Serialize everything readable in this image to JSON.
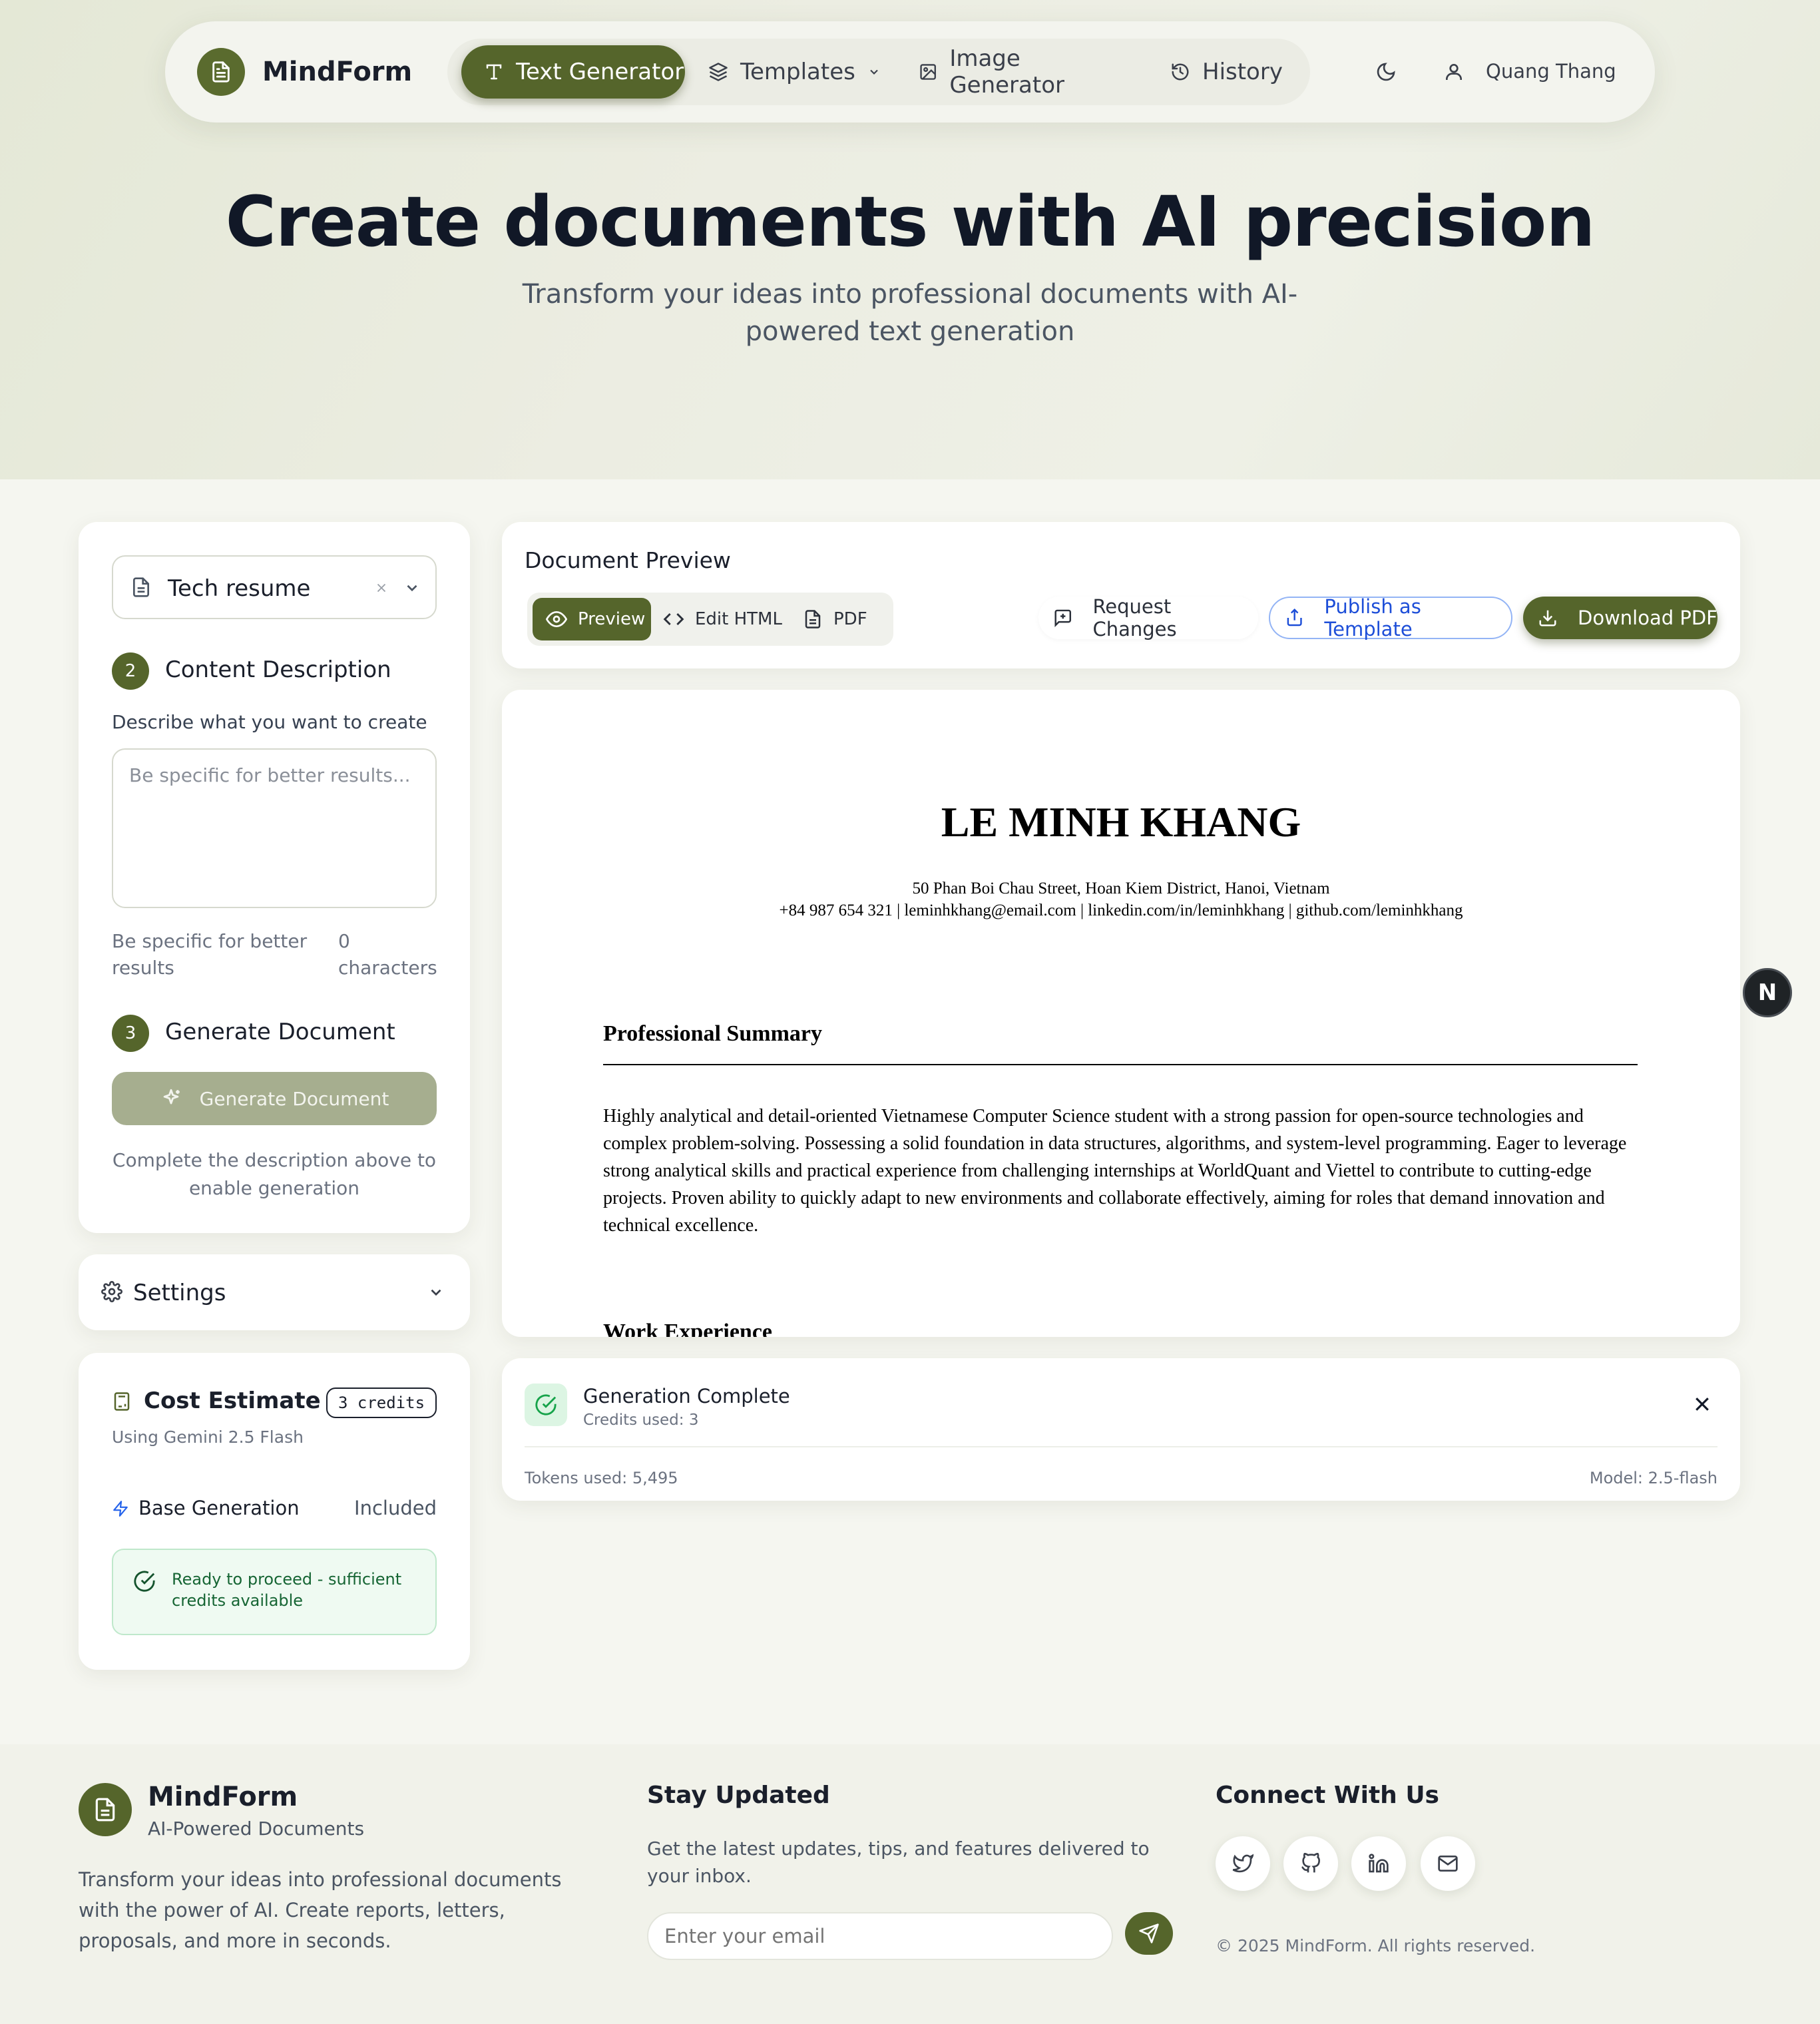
{
  "brand": {
    "name": "MindForm"
  },
  "nav": {
    "tabs": [
      {
        "label": "Text Generator",
        "icon": "text-icon",
        "active": true
      },
      {
        "label": "Templates",
        "icon": "layers-icon",
        "active": false
      },
      {
        "label": "Image Generator",
        "icon": "image-icon",
        "active": false
      },
      {
        "label": "History",
        "icon": "history-icon",
        "active": false
      }
    ],
    "user_name": "Quang Thang"
  },
  "hero": {
    "title": "Create documents with AI precision",
    "subtitle": "Transform your ideas into professional documents with AI-powered text generation"
  },
  "left": {
    "template_select": {
      "value": "Tech resume"
    },
    "step2": {
      "number": "2",
      "label": "Content Description"
    },
    "description_label": "Describe what you want to create",
    "textarea_placeholder": "Be specific for better results...",
    "hint": "Be specific for better results",
    "char_count": "0 characters",
    "step3": {
      "number": "3",
      "label": "Generate Document"
    },
    "generate_button": "Generate Document",
    "generate_hint": "Complete the description above to enable generation",
    "settings_label": "Settings",
    "cost": {
      "title": "Cost Estimate",
      "credits": "3 credits",
      "model": "Using Gemini 2.5 Flash",
      "base_label": "Base Generation",
      "base_value": "Included",
      "ready": "Ready to proceed - sufficient credits available"
    }
  },
  "preview": {
    "title": "Document Preview",
    "views": [
      "Preview",
      "Edit HTML",
      "PDF"
    ],
    "request_changes": "Request Changes",
    "publish": "Publish as Template",
    "download": "Download PDF"
  },
  "document": {
    "name": "LE MINH KHANG",
    "address": "50 Phan Boi Chau Street, Hoan Kiem District, Hanoi, Vietnam",
    "contacts": "+84 987 654 321 | leminhkhang@email.com | linkedin.com/in/leminhkhang | github.com/leminhkhang",
    "summary_heading": "Professional Summary",
    "summary": "Highly analytical and detail-oriented Vietnamese Computer Science student with a strong passion for open-source technologies and complex problem-solving. Possessing a solid foundation in data structures, algorithms, and system-level programming. Eager to leverage strong analytical skills and practical experience from challenging internships at WorldQuant and Viettel to contribute to cutting-edge projects. Proven ability to quickly adapt to new environments and collaborate effectively, aiming for roles that demand innovation and technical excellence.",
    "next_heading": "Work Experience"
  },
  "status": {
    "title": "Generation Complete",
    "credits_used": "Credits used: 3",
    "tokens": "Tokens used: 5,495",
    "model": "Model: 2.5-flash"
  },
  "fab_letter": "N",
  "footer": {
    "brand": "MindForm",
    "tagline": "AI-Powered Documents",
    "description": "Transform your ideas into professional documents with the power of AI. Create reports, letters, proposals, and more in seconds.",
    "newsletter_title": "Stay Updated",
    "newsletter_text": "Get the latest updates, tips, and features delivered to your inbox.",
    "email_placeholder": "Enter your email",
    "connect_title": "Connect With Us",
    "social": [
      "twitter-icon",
      "github-icon",
      "linkedin-icon",
      "mail-icon"
    ],
    "copyright": "© 2025 MindForm. All rights reserved."
  },
  "colors": {
    "accent": "#55652b",
    "success": "#16a34a",
    "link": "#1d4ed8"
  }
}
